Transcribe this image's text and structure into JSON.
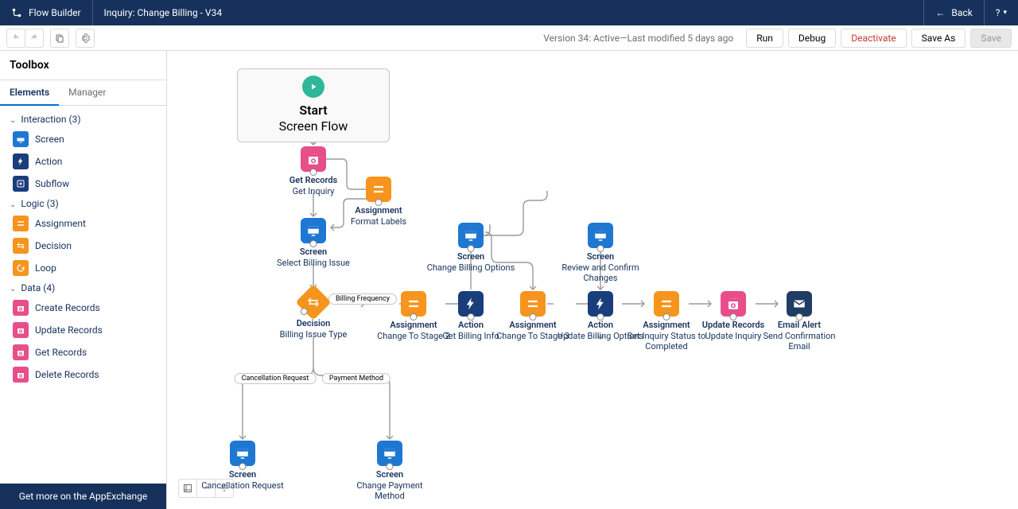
{
  "header": {
    "app": "Flow Builder",
    "title": "Inquiry: Change Billing - V34",
    "back": "Back",
    "help": "?"
  },
  "toolbar": {
    "version": "Version 34: Active—Last modified 5 days ago",
    "run": "Run",
    "debug": "Debug",
    "deactivate": "Deactivate",
    "saveas": "Save As",
    "save": "Save"
  },
  "sidebar": {
    "title": "Toolbox",
    "tabs": [
      "Elements",
      "Manager"
    ],
    "groups": [
      {
        "label": "Interaction (3)",
        "items": [
          {
            "name": "Screen",
            "c": "c-blue",
            "ic": "screen"
          },
          {
            "name": "Action",
            "c": "c-nvy",
            "ic": "bolt"
          },
          {
            "name": "Subflow",
            "c": "c-nvy",
            "ic": "sub"
          }
        ]
      },
      {
        "label": "Logic (3)",
        "items": [
          {
            "name": "Assignment",
            "c": "c-org",
            "ic": "eq"
          },
          {
            "name": "Decision",
            "c": "c-org",
            "ic": "dia"
          },
          {
            "name": "Loop",
            "c": "c-org",
            "ic": "loop"
          }
        ]
      },
      {
        "label": "Data (4)",
        "items": [
          {
            "name": "Create Records",
            "c": "c-pnk",
            "ic": "rec"
          },
          {
            "name": "Update Records",
            "c": "c-pnk",
            "ic": "rec"
          },
          {
            "name": "Get Records",
            "c": "c-pnk",
            "ic": "rec"
          },
          {
            "name": "Delete Records",
            "c": "c-pnk",
            "ic": "rec"
          }
        ]
      }
    ],
    "footer": "Get more on the AppExchange"
  },
  "canvas": {
    "start": {
      "title": "Start",
      "sub": "Screen Flow"
    },
    "nodes": {
      "getrec": {
        "t": "Get Records",
        "s": "Get Inquiry",
        "c": "c-pnk",
        "ic": "rec"
      },
      "asn1": {
        "t": "Assignment",
        "s": "Format Labels",
        "c": "c-org",
        "ic": "eq"
      },
      "scr1": {
        "t": "Screen",
        "s": "Select Billing Issue",
        "c": "c-blue",
        "ic": "screen"
      },
      "dec": {
        "t": "Decision",
        "s": "Billing Issue Type",
        "c": "c-org",
        "ic": "dia",
        "dia": true
      },
      "asn2": {
        "t": "Assignment",
        "s": "Change To Stage 2",
        "c": "c-org",
        "ic": "eq"
      },
      "act1": {
        "t": "Action",
        "s": "Get Billing Info",
        "c": "c-nvy",
        "ic": "bolt"
      },
      "asn3": {
        "t": "Assignment",
        "s": "Change To Stage 3",
        "c": "c-org",
        "ic": "eq"
      },
      "scr2": {
        "t": "Screen",
        "s": "Change Billing Options",
        "c": "c-blue",
        "ic": "screen"
      },
      "scr3": {
        "t": "Screen",
        "s": "Review and Confirm Changes",
        "c": "c-blue",
        "ic": "screen"
      },
      "act2": {
        "t": "Action",
        "s": "Update Billing Options",
        "c": "c-nvy",
        "ic": "bolt"
      },
      "asn4": {
        "t": "Assignment",
        "s": "Set Inquiry Status to Completed",
        "c": "c-org",
        "ic": "eq"
      },
      "upd": {
        "t": "Update Records",
        "s": "Update Inquiry",
        "c": "c-pnk",
        "ic": "rec"
      },
      "eml": {
        "t": "Email Alert",
        "s": "Send Confirmation Email",
        "c": "c-env",
        "ic": "env"
      },
      "scr4": {
        "t": "Screen",
        "s": "Cancellation Request",
        "c": "c-blue",
        "ic": "screen"
      },
      "scr5": {
        "t": "Screen",
        "s": "Change Payment Method",
        "c": "c-blue",
        "ic": "screen"
      }
    },
    "labels": {
      "bf": "Billing Frequency",
      "cr": "Cancellation Request",
      "pm": "Payment Method"
    }
  }
}
